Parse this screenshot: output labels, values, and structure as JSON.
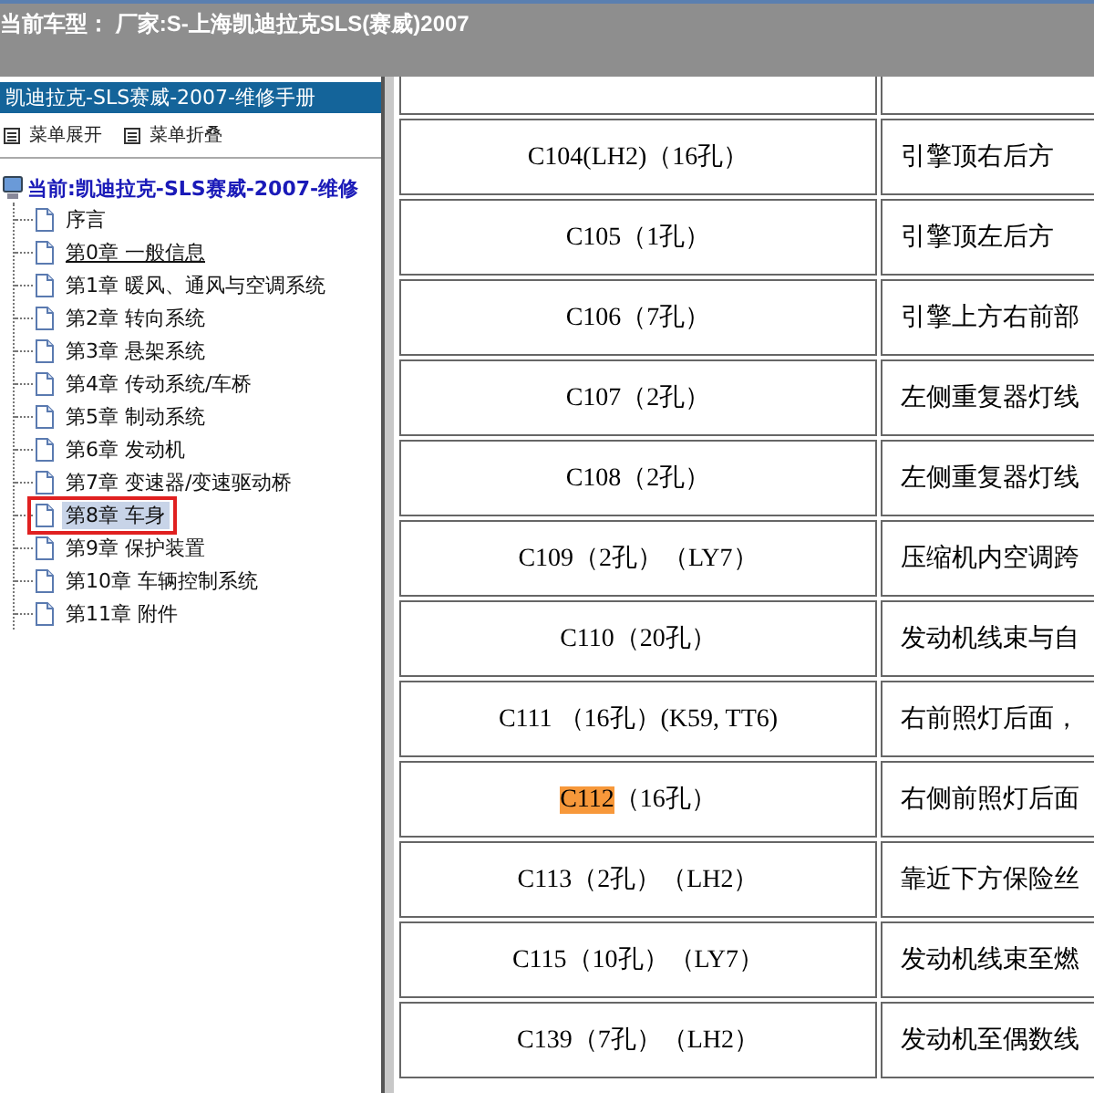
{
  "header": {
    "title": "当前车型： 厂家:S-上海凯迪拉克SLS(赛威)2007"
  },
  "sidebar": {
    "title": "凯迪拉克-SLS赛威-2007-维修手册",
    "menu": [
      {
        "label": "菜单展开"
      },
      {
        "label": "菜单折叠"
      }
    ],
    "tree": {
      "label": "当前:凯迪拉克-SLS赛威-2007-维修",
      "children": [
        {
          "label": "序言",
          "selected": false,
          "hovered": false,
          "marked": false
        },
        {
          "label": "第0章 一般信息",
          "selected": false,
          "hovered": true,
          "marked": false
        },
        {
          "label": "第1章 暖风、通风与空调系统",
          "selected": false,
          "hovered": false,
          "marked": false
        },
        {
          "label": "第2章 转向系统",
          "selected": false,
          "hovered": false,
          "marked": false
        },
        {
          "label": "第3章 悬架系统",
          "selected": false,
          "hovered": false,
          "marked": false
        },
        {
          "label": "第4章 传动系统/车桥",
          "selected": false,
          "hovered": false,
          "marked": false
        },
        {
          "label": "第5章 制动系统",
          "selected": false,
          "hovered": false,
          "marked": false
        },
        {
          "label": "第6章 发动机",
          "selected": false,
          "hovered": false,
          "marked": false
        },
        {
          "label": "第7章 变速器/变速驱动桥",
          "selected": false,
          "hovered": false,
          "marked": false
        },
        {
          "label": "第8章 车身",
          "selected": true,
          "hovered": false,
          "marked": true
        },
        {
          "label": "第9章 保护装置",
          "selected": false,
          "hovered": false,
          "marked": false
        },
        {
          "label": "第10章 车辆控制系统",
          "selected": false,
          "hovered": false,
          "marked": false
        },
        {
          "label": "第11章 附件",
          "selected": false,
          "hovered": false,
          "marked": false
        }
      ]
    }
  },
  "table": {
    "rows": [
      {
        "code": "C104(LH2)",
        "spec": "（16孔）",
        "location": "引擎顶右后方",
        "highlighted": false
      },
      {
        "code": "C105",
        "spec": "（1孔）",
        "location": "引擎顶左后方",
        "highlighted": false
      },
      {
        "code": "C106",
        "spec": "（7孔）",
        "location": "引擎上方右前部",
        "highlighted": false
      },
      {
        "code": "C107",
        "spec": "（2孔）",
        "location": "左侧重复器灯线",
        "highlighted": false
      },
      {
        "code": "C108",
        "spec": "（2孔）",
        "location": "左侧重复器灯线",
        "highlighted": false
      },
      {
        "code": "C109",
        "spec": "（2孔）（LY7）",
        "location": "压缩机内空调跨",
        "highlighted": false
      },
      {
        "code": "C110",
        "spec": "（20孔）",
        "location": "发动机线束与自",
        "highlighted": false
      },
      {
        "code": "C111",
        "spec": " （16孔）(K59, TT6)",
        "location": "右前照灯后面，",
        "highlighted": false
      },
      {
        "code": "C112",
        "spec": "（16孔）",
        "location": "右侧前照灯后面",
        "highlighted": true
      },
      {
        "code": "C113",
        "spec": "（2孔）（LH2）",
        "location": "靠近下方保险丝",
        "highlighted": false
      },
      {
        "code": "C115",
        "spec": "（10孔）（LY7）",
        "location": "发动机线束至燃",
        "highlighted": false
      },
      {
        "code": "C139",
        "spec": "（7孔）（LH2）",
        "location": "发动机至偶数线",
        "highlighted": false
      }
    ]
  }
}
